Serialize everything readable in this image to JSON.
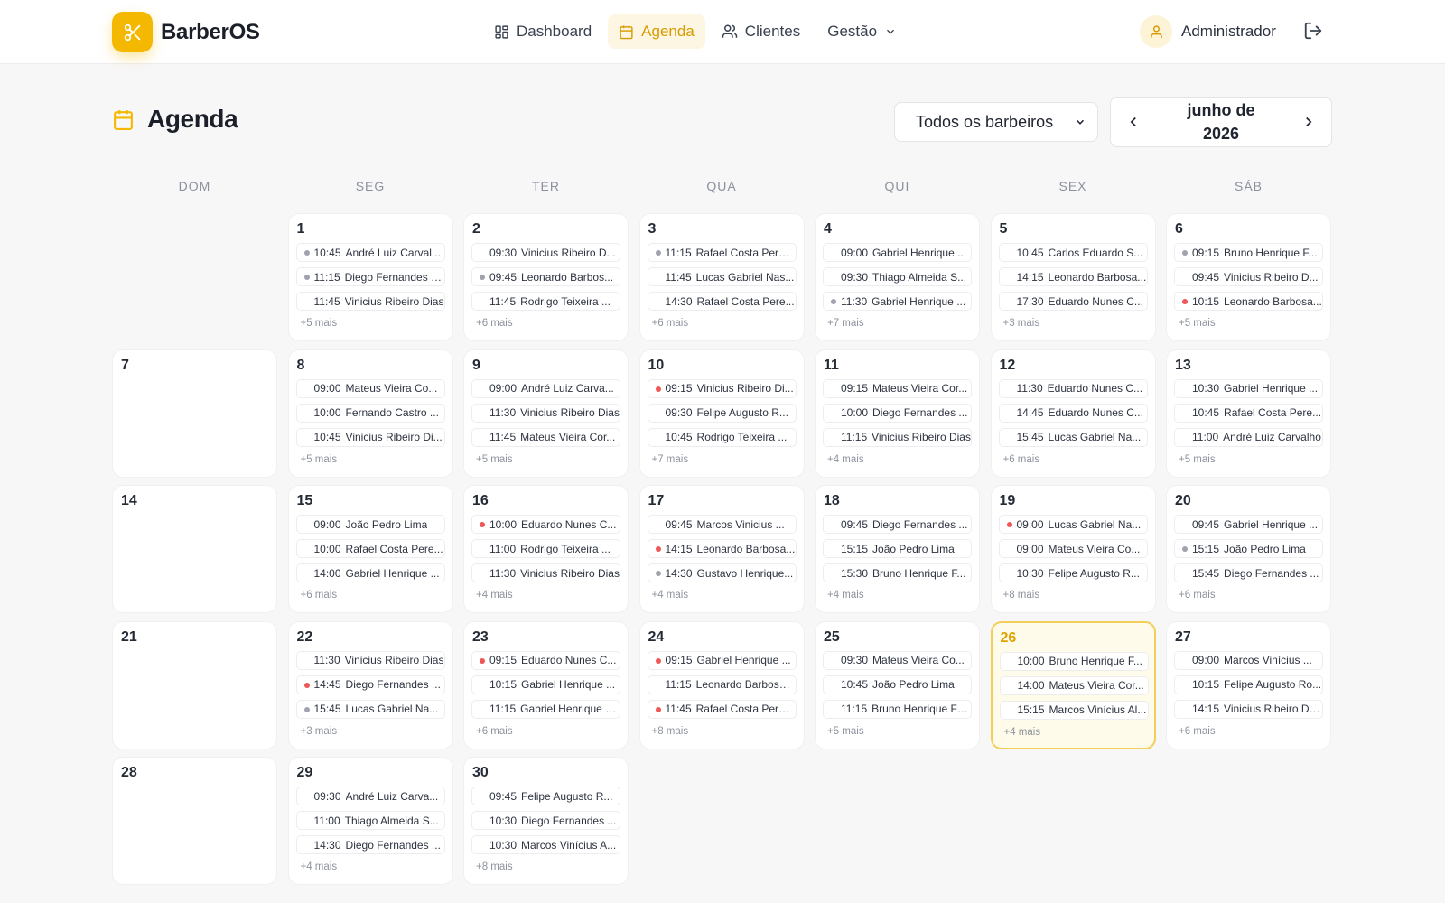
{
  "app": {
    "name": "BarberOS",
    "logo_icon": "scissors-icon"
  },
  "nav": {
    "items": [
      {
        "label": "Dashboard",
        "icon": "dashboard-icon"
      },
      {
        "label": "Agenda",
        "icon": "calendar-icon",
        "active": true
      },
      {
        "label": "Clientes",
        "icon": "users-icon"
      },
      {
        "label": "Gestão",
        "icon": "chevron-down-icon"
      }
    ]
  },
  "user": {
    "name": "Administrador"
  },
  "page": {
    "title": "Agenda"
  },
  "filters": {
    "barber_select": "Todos os barbeiros",
    "month_line1": "junho de",
    "month_line2": "2026"
  },
  "weekdays": [
    "DOM",
    "SEG",
    "TER",
    "QUA",
    "QUI",
    "SEX",
    "SÁB"
  ],
  "colors": {
    "accent": "#f5b800",
    "accent_text": "#d89a00",
    "dot_gray": "#9ea3ad",
    "dot_red": "#ef5656",
    "today_border": "#f3cf5a"
  },
  "calendar": {
    "today": 26,
    "days": [
      {
        "day": "1",
        "more": "+5 mais",
        "appts": [
          {
            "time": "10:45",
            "name": "André Luiz Carval...",
            "dot": "gray"
          },
          {
            "time": "11:15",
            "name": "Diego Fernandes S...",
            "dot": "gray"
          },
          {
            "time": "11:45",
            "name": "Vinicius Ribeiro Dias"
          }
        ]
      },
      {
        "day": "2",
        "more": "+6 mais",
        "appts": [
          {
            "time": "09:30",
            "name": "Vinicius Ribeiro D..."
          },
          {
            "time": "09:45",
            "name": "Leonardo Barbos...",
            "dot": "gray"
          },
          {
            "time": "11:45",
            "name": "Rodrigo Teixeira ..."
          }
        ]
      },
      {
        "day": "3",
        "more": "+6 mais",
        "appts": [
          {
            "time": "11:15",
            "name": "Rafael Costa Pereira",
            "dot": "gray"
          },
          {
            "time": "11:45",
            "name": "Lucas Gabriel Nas..."
          },
          {
            "time": "14:30",
            "name": "Rafael Costa Pere..."
          }
        ]
      },
      {
        "day": "4",
        "more": "+7 mais",
        "appts": [
          {
            "time": "09:00",
            "name": "Gabriel Henrique ..."
          },
          {
            "time": "09:30",
            "name": "Thiago Almeida S..."
          },
          {
            "time": "11:30",
            "name": "Gabriel Henrique ...",
            "dot": "gray"
          }
        ]
      },
      {
        "day": "5",
        "more": "+3 mais",
        "appts": [
          {
            "time": "10:45",
            "name": "Carlos Eduardo S..."
          },
          {
            "time": "14:15",
            "name": "Leonardo Barbosa..."
          },
          {
            "time": "17:30",
            "name": "Eduardo Nunes C..."
          }
        ]
      },
      {
        "day": "6",
        "more": "+5 mais",
        "appts": [
          {
            "time": "09:15",
            "name": "Bruno Henrique F...",
            "dot": "gray"
          },
          {
            "time": "09:45",
            "name": "Vinicius Ribeiro D..."
          },
          {
            "time": "10:15",
            "name": "Leonardo Barbosa...",
            "dot": "red"
          }
        ]
      },
      {
        "day": "7",
        "more": "",
        "appts": []
      },
      {
        "day": "8",
        "more": "+5 mais",
        "appts": [
          {
            "time": "09:00",
            "name": "Mateus Vieira Co..."
          },
          {
            "time": "10:00",
            "name": "Fernando Castro ..."
          },
          {
            "time": "10:45",
            "name": "Vinicius Ribeiro Di..."
          }
        ]
      },
      {
        "day": "9",
        "more": "+5 mais",
        "appts": [
          {
            "time": "09:00",
            "name": "André Luiz Carva..."
          },
          {
            "time": "11:30",
            "name": "Vinicius Ribeiro Dias"
          },
          {
            "time": "11:45",
            "name": "Mateus Vieira Cor..."
          }
        ]
      },
      {
        "day": "10",
        "more": "+7 mais",
        "appts": [
          {
            "time": "09:15",
            "name": "Vinicius Ribeiro Di...",
            "dot": "red"
          },
          {
            "time": "09:30",
            "name": "Felipe Augusto R..."
          },
          {
            "time": "10:45",
            "name": "Rodrigo Teixeira ..."
          }
        ]
      },
      {
        "day": "11",
        "more": "+4 mais",
        "appts": [
          {
            "time": "09:15",
            "name": "Mateus Vieira Cor..."
          },
          {
            "time": "10:00",
            "name": "Diego Fernandes ..."
          },
          {
            "time": "11:15",
            "name": "Vinicius Ribeiro Dias"
          }
        ]
      },
      {
        "day": "12",
        "more": "+6 mais",
        "appts": [
          {
            "time": "11:30",
            "name": "Eduardo Nunes C..."
          },
          {
            "time": "14:45",
            "name": "Eduardo Nunes C..."
          },
          {
            "time": "15:45",
            "name": "Lucas Gabriel Na..."
          }
        ]
      },
      {
        "day": "13",
        "more": "+5 mais",
        "appts": [
          {
            "time": "10:30",
            "name": "Gabriel Henrique ..."
          },
          {
            "time": "10:45",
            "name": "Rafael Costa Pere..."
          },
          {
            "time": "11:00",
            "name": "André Luiz Carvalho"
          }
        ]
      },
      {
        "day": "14",
        "more": "",
        "appts": []
      },
      {
        "day": "15",
        "more": "+6 mais",
        "appts": [
          {
            "time": "09:00",
            "name": "João Pedro Lima"
          },
          {
            "time": "10:00",
            "name": "Rafael Costa Pere..."
          },
          {
            "time": "14:00",
            "name": "Gabriel Henrique ..."
          }
        ]
      },
      {
        "day": "16",
        "more": "+4 mais",
        "appts": [
          {
            "time": "10:00",
            "name": "Eduardo Nunes C...",
            "dot": "red"
          },
          {
            "time": "11:00",
            "name": "Rodrigo Teixeira ..."
          },
          {
            "time": "11:30",
            "name": "Vinicius Ribeiro Dias"
          }
        ]
      },
      {
        "day": "17",
        "more": "+4 mais",
        "appts": [
          {
            "time": "09:45",
            "name": "Marcos Vinicius ..."
          },
          {
            "time": "14:15",
            "name": "Leonardo Barbosa...",
            "dot": "red"
          },
          {
            "time": "14:30",
            "name": "Gustavo Henrique...",
            "dot": "gray"
          }
        ]
      },
      {
        "day": "18",
        "more": "+4 mais",
        "appts": [
          {
            "time": "09:45",
            "name": "Diego Fernandes ..."
          },
          {
            "time": "15:15",
            "name": "João Pedro Lima"
          },
          {
            "time": "15:30",
            "name": "Bruno Henrique F..."
          }
        ]
      },
      {
        "day": "19",
        "more": "+8 mais",
        "appts": [
          {
            "time": "09:00",
            "name": "Lucas Gabriel Na...",
            "dot": "red"
          },
          {
            "time": "09:00",
            "name": "Mateus Vieira Co..."
          },
          {
            "time": "10:30",
            "name": "Felipe Augusto R..."
          }
        ]
      },
      {
        "day": "20",
        "more": "+6 mais",
        "appts": [
          {
            "time": "09:45",
            "name": "Gabriel Henrique ..."
          },
          {
            "time": "15:15",
            "name": "João Pedro Lima",
            "dot": "gray"
          },
          {
            "time": "15:45",
            "name": "Diego Fernandes ..."
          }
        ]
      },
      {
        "day": "21",
        "more": "",
        "appts": []
      },
      {
        "day": "22",
        "more": "+3 mais",
        "appts": [
          {
            "time": "11:30",
            "name": "Vinicius Ribeiro Dias"
          },
          {
            "time": "14:45",
            "name": "Diego Fernandes ...",
            "dot": "red"
          },
          {
            "time": "15:45",
            "name": "Lucas Gabriel Na...",
            "dot": "gray"
          }
        ]
      },
      {
        "day": "23",
        "more": "+6 mais",
        "appts": [
          {
            "time": "09:15",
            "name": "Eduardo Nunes C...",
            "dot": "red"
          },
          {
            "time": "10:15",
            "name": "Gabriel Henrique ..."
          },
          {
            "time": "11:15",
            "name": "Gabriel Henrique P..."
          }
        ]
      },
      {
        "day": "24",
        "more": "+8 mais",
        "appts": [
          {
            "time": "09:15",
            "name": "Gabriel Henrique ...",
            "dot": "red"
          },
          {
            "time": "11:15",
            "name": "Leonardo Barbosa ..."
          },
          {
            "time": "11:45",
            "name": "Rafael Costa Pereira",
            "dot": "red"
          }
        ]
      },
      {
        "day": "25",
        "more": "+5 mais",
        "appts": [
          {
            "time": "09:30",
            "name": "Mateus Vieira Co..."
          },
          {
            "time": "10:45",
            "name": "João Pedro Lima"
          },
          {
            "time": "11:15",
            "name": "Bruno Henrique Fe..."
          }
        ]
      },
      {
        "day": "26",
        "more": "+4 mais",
        "appts": [
          {
            "time": "10:00",
            "name": "Bruno Henrique F..."
          },
          {
            "time": "14:00",
            "name": "Mateus Vieira Cor..."
          },
          {
            "time": "15:15",
            "name": "Marcos Vinícius Al..."
          }
        ]
      },
      {
        "day": "27",
        "more": "+6 mais",
        "appts": [
          {
            "time": "09:00",
            "name": "Marcos Vinícius ..."
          },
          {
            "time": "10:15",
            "name": "Felipe Augusto Ro..."
          },
          {
            "time": "14:15",
            "name": "Vinicius Ribeiro Dias"
          }
        ]
      },
      {
        "day": "28",
        "more": "",
        "appts": []
      },
      {
        "day": "29",
        "more": "+4 mais",
        "appts": [
          {
            "time": "09:30",
            "name": "André Luiz Carva..."
          },
          {
            "time": "11:00",
            "name": "Thiago Almeida S..."
          },
          {
            "time": "14:30",
            "name": "Diego Fernandes ..."
          }
        ]
      },
      {
        "day": "30",
        "more": "+8 mais",
        "appts": [
          {
            "time": "09:45",
            "name": "Felipe Augusto R..."
          },
          {
            "time": "10:30",
            "name": "Diego Fernandes ..."
          },
          {
            "time": "10:30",
            "name": "Marcos Vinícius A..."
          }
        ]
      }
    ]
  }
}
